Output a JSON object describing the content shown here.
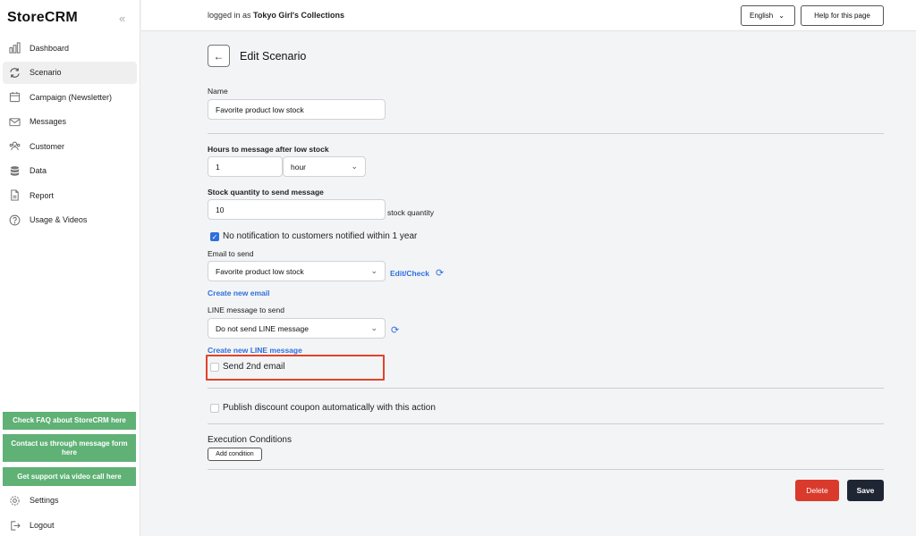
{
  "app": {
    "name": "StoreCRM",
    "collapse_glyph": "«"
  },
  "sidebar": {
    "items": [
      {
        "label": "Dashboard",
        "icon": "bar-chart-icon"
      },
      {
        "label": "Scenario",
        "icon": "refresh-icon",
        "active": true
      },
      {
        "label": "Campaign (Newsletter)",
        "icon": "calendar-icon"
      },
      {
        "label": "Messages",
        "icon": "mail-icon"
      },
      {
        "label": "Customer",
        "icon": "users-icon"
      },
      {
        "label": "Data",
        "icon": "database-icon"
      },
      {
        "label": "Report",
        "icon": "document-icon"
      },
      {
        "label": "Usage & Videos",
        "icon": "help-circle-icon"
      }
    ],
    "faq_button": "Check FAQ about StoreCRM here",
    "contact_button": "Contact us through message form here",
    "support_button": "Get support via video call here",
    "settings_label": "Settings",
    "logout_label": "Logout",
    "accent_color": "#5fb175"
  },
  "topbar": {
    "login_prefix": "logged in as ",
    "user": "Tokyo Girl's Collections",
    "language": "English",
    "help": "Help for this page"
  },
  "page": {
    "title": "Edit Scenario",
    "back_glyph": "←"
  },
  "form": {
    "name_label": "Name",
    "name_value": "Favorite product low stock",
    "hours_label": "Hours to message after low stock",
    "hours_value": "1",
    "hours_unit": "hour",
    "stock_label": "Stock quantity to send message",
    "stock_value": "10",
    "stock_suffix": "stock quantity",
    "no_notify_label": "No notification to customers notified within 1 year",
    "no_notify_checked": true,
    "email_label": "Email to send",
    "email_value": "Favorite product low stock",
    "edit_check": "Edit/Check",
    "create_email": "Create new email",
    "line_label": "LINE message to send",
    "line_value": "Do not send LINE message",
    "create_line": "Create new LINE message",
    "second_email_label": "Send 2nd email",
    "second_email_checked": false,
    "coupon_label": "Publish discount coupon automatically with this action",
    "coupon_checked": false,
    "conditions_label": "Execution Conditions",
    "add_condition": "Add condition"
  },
  "actions": {
    "delete": "Delete",
    "save": "Save"
  },
  "colors": {
    "link": "#2f6fdd",
    "delete": "#d93a2b",
    "save": "#1f2633",
    "highlight": "#e2422a"
  }
}
